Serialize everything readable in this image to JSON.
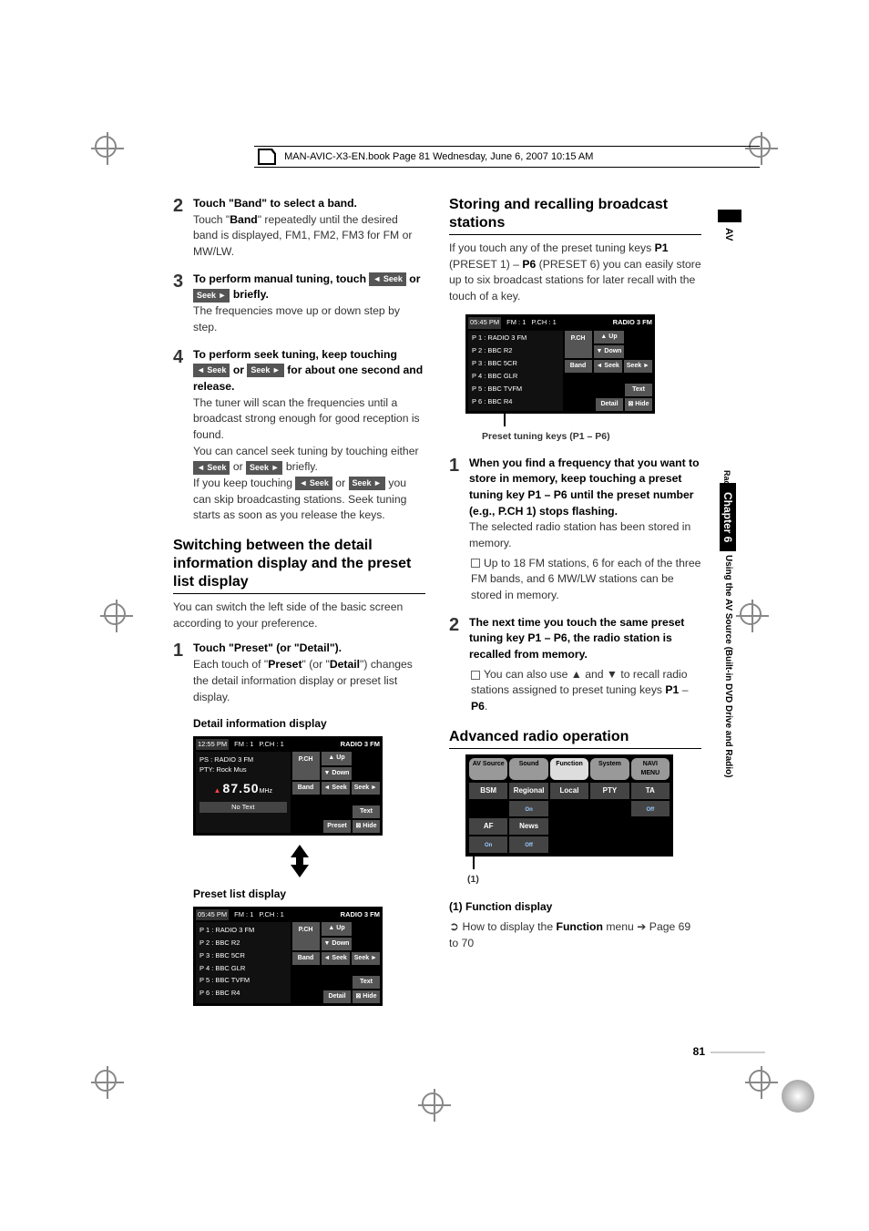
{
  "header": "MAN-AVIC-X3-EN.book  Page 81  Wednesday, June 6, 2007  10:15 AM",
  "pageNumber": "81",
  "sideAV": "AV",
  "sideRadio": "Radio",
  "sideChapter": "Chapter 6",
  "sideUsing": "Using the AV Source (Built-in DVD Drive and Radio)",
  "seekLeft": "◄ Seek",
  "seekRight": "Seek ►",
  "left": {
    "step2": {
      "num": "2",
      "title": "Touch \"Band\" to select a band.",
      "body1": "Touch \"",
      "band": "Band",
      "body2": "\" repeatedly until the desired band is displayed, FM1, FM2, FM3 for FM or MW/LW."
    },
    "step3": {
      "num": "3",
      "title1": "To perform manual tuning, touch ",
      "title2": " or ",
      "title3": " briefly.",
      "body": "The frequencies move up or down step by step."
    },
    "step4": {
      "num": "4",
      "title1": "To perform seek tuning, keep touching ",
      "title2": " or ",
      "title3": " for about one second and release.",
      "body1": "The tuner will scan the frequencies until a broadcast strong enough for good reception is found.",
      "body2": "You can cancel seek tuning by touching either ",
      "body3": " or ",
      "body4": " briefly.",
      "body5": "If you keep touching ",
      "body6": " or ",
      "body7": " you can skip broadcasting stations. Seek tuning starts as soon as you release the keys."
    },
    "secSwitch": "Switching between the detail information display and the preset list display",
    "switchBody": "You can switch the left side of the basic screen according to your preference.",
    "step1b": {
      "num": "1",
      "title": "Touch \"Preset\" (or \"Detail\").",
      "body1": "Each touch of \"",
      "preset": "Preset",
      "body2": "\" (or \"",
      "detail": "Detail",
      "body3": "\") changes the detail information display or preset list display."
    },
    "detailHeading": "Detail information display",
    "presetHeading": "Preset list display"
  },
  "right": {
    "secStore": "Storing and recalling broadcast stations",
    "storeBody1": "If you touch any of the preset tuning keys ",
    "p1": "P1",
    "storeBody2": " (PRESET 1) – ",
    "p6": "P6",
    "storeBody3": " (PRESET 6) you can easily store up to six broadcast stations for later recall with the touch of a key.",
    "presetKeysCaption": "Preset tuning keys (P1 – P6)",
    "step1": {
      "num": "1",
      "title": "When you find a frequency that you want to store in memory, keep touching a preset tuning key P1 – P6 until the preset number (e.g., P.CH 1) stops flashing.",
      "body": "The selected radio station has been stored in memory.",
      "bullet": "Up to 18 FM stations, 6 for each of the three FM bands, and 6 MW/LW stations can be stored in memory."
    },
    "step2": {
      "num": "2",
      "title": "The next time you touch the same preset tuning key P1 – P6, the radio station is recalled from memory.",
      "bullet1": "You can also use ▲ and ▼ to recall radio stations assigned to preset tuning keys ",
      "bullet2": " – ",
      "bullet3": "."
    },
    "secAdvanced": "Advanced radio operation",
    "fnLabel": "(1)",
    "fnHeading": "(1) Function display",
    "fnBody1": "How to display the ",
    "fnBold": "Function",
    "fnBody2": " menu ➔ Page 69 to 70"
  },
  "screens": {
    "detail": {
      "time": "12:55 PM",
      "fm": "FM : 1",
      "pch": "P.CH : 1",
      "band": "RADIO 3 FM",
      "ps": "PS    : RADIO 3 FM",
      "pty": "PTY: Rock Mus",
      "freq": "87.50",
      "mhz": "MHz",
      "notext": "No Text",
      "btns": [
        "P.CH",
        "▲ Up",
        "▼ Down",
        "Band",
        "◄ Seek",
        "Seek ►",
        "Text",
        "Preset",
        "⊠ Hide"
      ]
    },
    "preset": {
      "time": "05:45 PM",
      "fm": "FM : 1",
      "pch": "P.CH : 1",
      "band": "RADIO 3 FM",
      "rows": [
        "P 1 : RADIO 3 FM",
        "P 2 : BBC  R2",
        "P 3 : BBC  5CR",
        "P 4 : BBC  GLR",
        "P 5 : BBC  TVFM",
        "P 6 : BBC  R4"
      ],
      "btns": [
        "P.CH",
        "▲ Up",
        "▼ Down",
        "Band",
        "◄ Seek",
        "Seek ►",
        "Text",
        "Detail",
        "⊠ Hide"
      ]
    },
    "fn": {
      "tabs": [
        "AV Source",
        "Sound",
        "Function",
        "System",
        "NAVI MENU"
      ],
      "cells": [
        "BSM",
        "Regional",
        "Local",
        "PTY",
        "TA",
        "",
        "On",
        "",
        "",
        "Off",
        "AF",
        "News",
        "",
        "",
        "",
        "On",
        "Off",
        "",
        "",
        ""
      ]
    }
  }
}
